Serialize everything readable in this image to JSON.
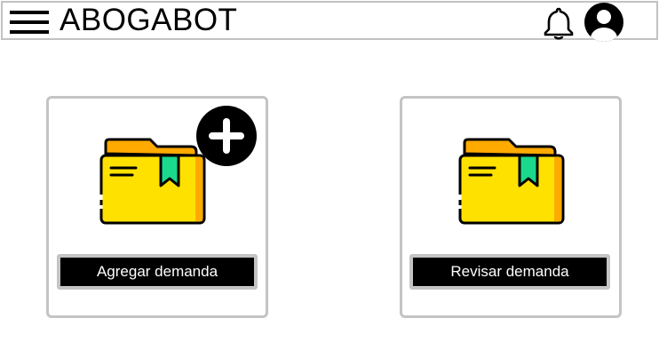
{
  "header": {
    "title": "ABOGABOT",
    "menu_icon": "hamburger-menu-icon",
    "notifications_icon": "bell-icon",
    "profile_icon": "user-avatar-icon"
  },
  "cards": [
    {
      "icon": "folder-add-icon",
      "button_label": "Agregar demanda"
    },
    {
      "icon": "folder-icon",
      "button_label": "Revisar demanda"
    }
  ],
  "colors": {
    "folder_yellow": "#FFE100",
    "folder_orange": "#FFAA00",
    "bookmark_green": "#1BD98C",
    "border_gray": "#C2C2C2",
    "button_bg": "#000000",
    "button_text": "#FFFFFF"
  }
}
